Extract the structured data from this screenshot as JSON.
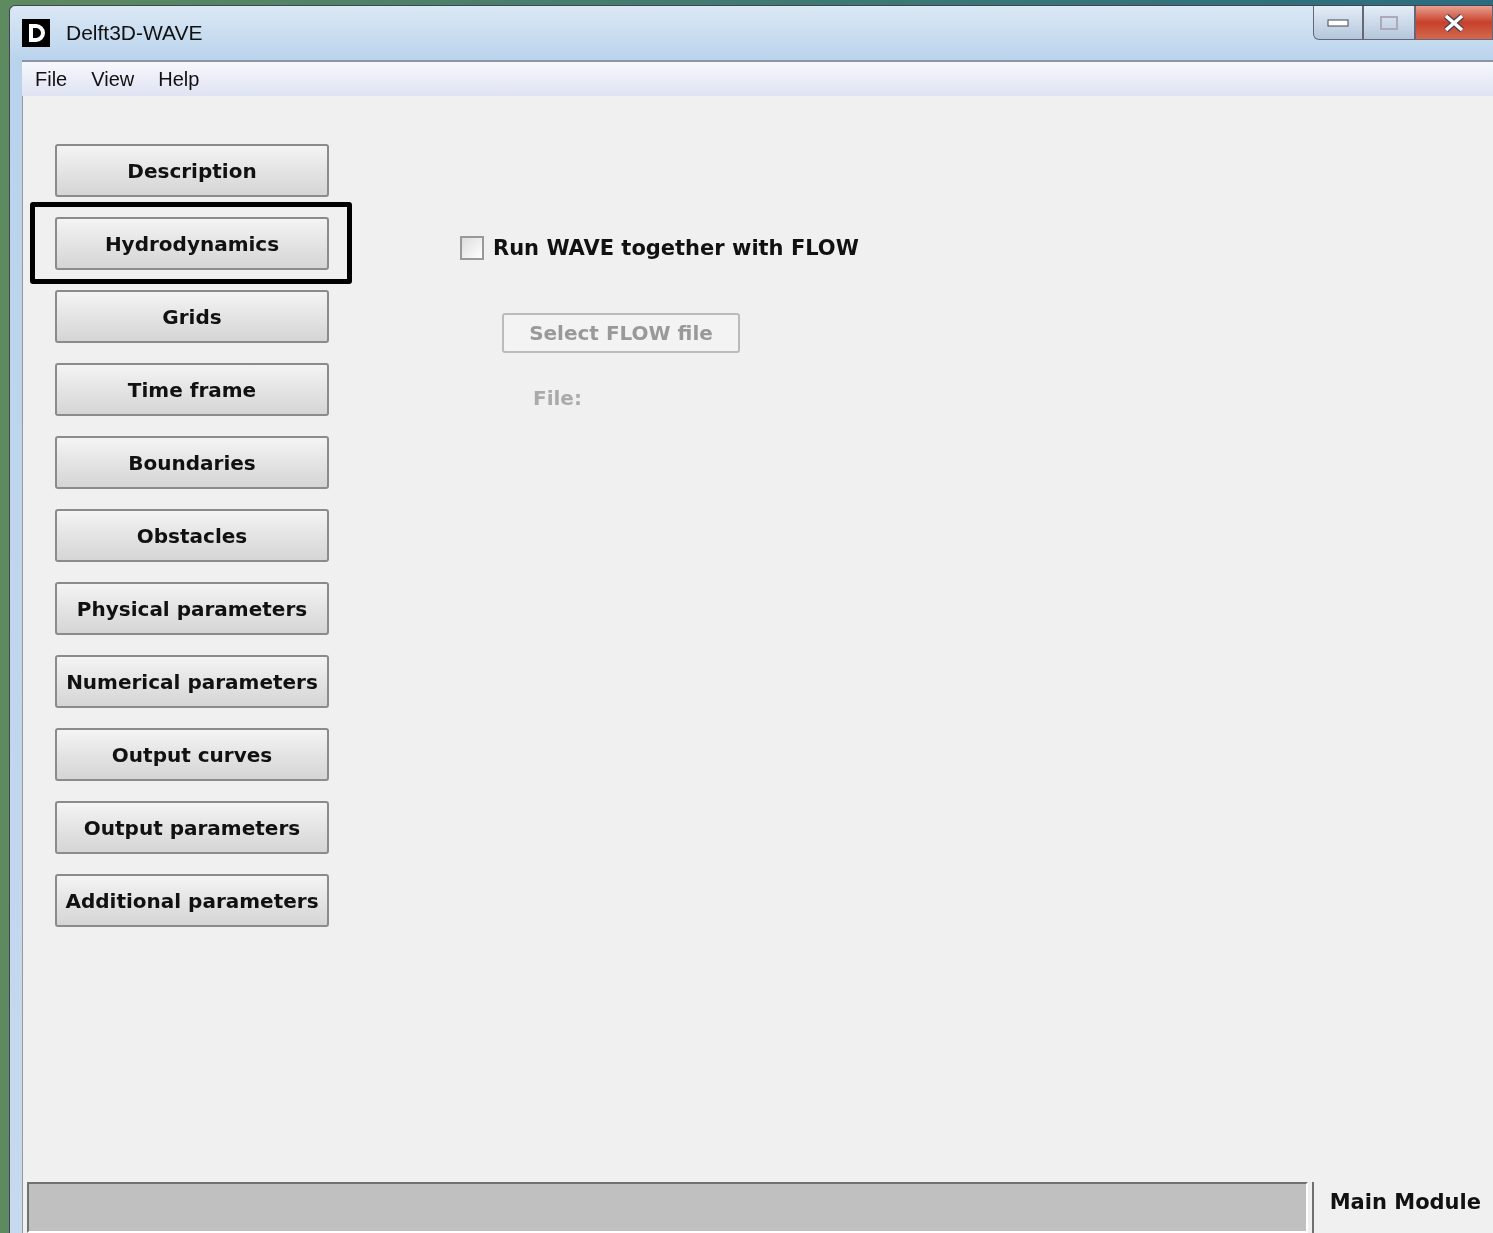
{
  "window": {
    "title": "Delft3D-WAVE"
  },
  "menu": [
    "File",
    "View",
    "Help"
  ],
  "nav": [
    {
      "label": "Description",
      "highlighted": false
    },
    {
      "label": "Hydrodynamics",
      "highlighted": true
    },
    {
      "label": "Grids",
      "highlighted": false
    },
    {
      "label": "Time frame",
      "highlighted": false
    },
    {
      "label": "Boundaries",
      "highlighted": false
    },
    {
      "label": "Obstacles",
      "highlighted": false
    },
    {
      "label": "Physical parameters",
      "highlighted": false
    },
    {
      "label": "Numerical parameters",
      "highlighted": false
    },
    {
      "label": "Output curves",
      "highlighted": false
    },
    {
      "label": "Output parameters",
      "highlighted": false
    },
    {
      "label": "Additional parameters",
      "highlighted": false
    }
  ],
  "run_with_flow": {
    "label": "Run WAVE together with FLOW",
    "checked": false
  },
  "select_button": {
    "label": "Select FLOW file",
    "disabled": true
  },
  "file_label": {
    "label": "File:",
    "disabled": true
  },
  "status_bar": {
    "module": "Main Module"
  }
}
